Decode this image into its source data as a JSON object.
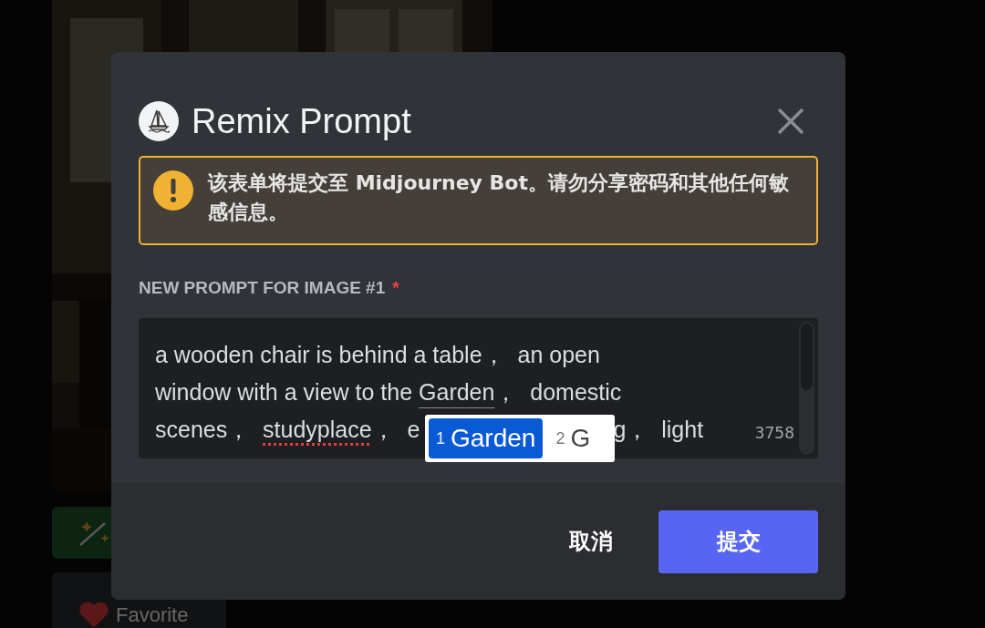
{
  "background": {
    "favorite_button": "Favorite"
  },
  "modal": {
    "title": "Remix Prompt",
    "warning": "该表单将提交至 Midjourney Bot。请勿分享密码和其他任何敏感信息。",
    "field": {
      "label": "NEW PROMPT FOR IMAGE #1",
      "required": true,
      "required_mark": "*",
      "lines": [
        [
          {
            "kind": "plain",
            "text": "a wooden chair is behind a table，  an open"
          }
        ],
        [
          {
            "kind": "plain",
            "text": "window with a view to the "
          },
          {
            "kind": "composition",
            "text": "Garden"
          },
          {
            "kind": "plain",
            "text": "，  domestic"
          }
        ],
        [
          {
            "kind": "plain",
            "text": "scenes，  "
          },
          {
            "kind": "spelling",
            "text": "studyplace"
          },
          {
            "kind": "plain",
            "text": "，  e"
          },
          {
            "kind": "plain",
            "text": "g，  light",
            "after_popup": true
          }
        ]
      ],
      "char_count": "3758"
    },
    "buttons": [
      {
        "label": "取消",
        "kind": "secondary"
      },
      {
        "label": "提交",
        "kind": "primary"
      }
    ]
  },
  "ime_candidates": [
    {
      "index": "1",
      "text": "Garden",
      "selected": true
    },
    {
      "index": "2",
      "text": "G",
      "selected": false
    }
  ]
}
